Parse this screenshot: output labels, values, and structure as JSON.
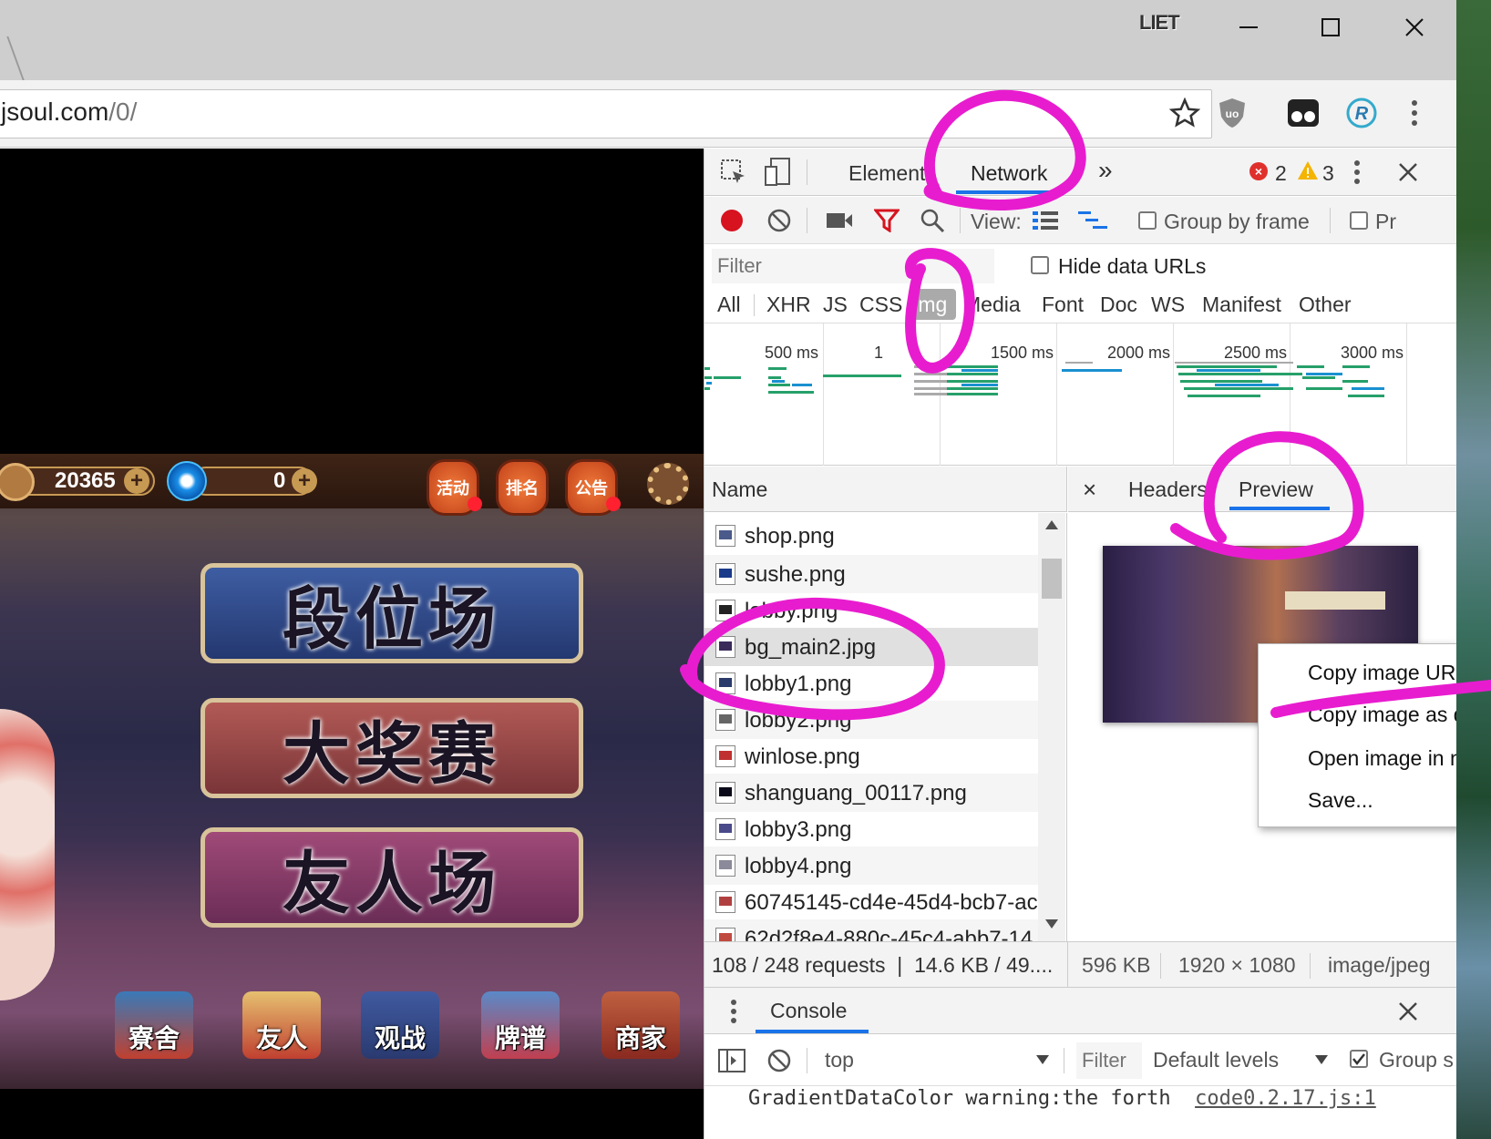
{
  "browser": {
    "user_badge": "LIET",
    "url_host": "jsoul.com",
    "url_path": "/0/"
  },
  "game": {
    "coins": "20365",
    "gems": "0",
    "lanterns": [
      "活动",
      "排名",
      "公告"
    ],
    "banners": [
      "段位场",
      "大奖赛",
      "友人场"
    ],
    "bottom_icons": [
      "寮舍",
      "友人",
      "观战",
      "牌谱",
      "商家"
    ]
  },
  "devtools": {
    "tabs": {
      "elements": "Elements",
      "network": "Network",
      "more": "»"
    },
    "errors": "2",
    "warnings": "3",
    "toolbar": {
      "view_label": "View:",
      "group_by_frame": "Group by frame",
      "preserve": "Pr"
    },
    "filter_placeholder": "Filter",
    "hide_data_urls": "Hide data URLs",
    "types": [
      "All",
      "XHR",
      "JS",
      "CSS",
      "Img",
      "Media",
      "Font",
      "Doc",
      "WS",
      "Manifest",
      "Other"
    ],
    "timeline_ticks": [
      "500 ms",
      "1",
      "1500 ms",
      "2000 ms",
      "2500 ms",
      "3000 ms"
    ],
    "name_header": "Name",
    "files": [
      "shop.png",
      "sushe.png",
      "lobby.png",
      "bg_main2.jpg",
      "lobby1.png",
      "lobby2.png",
      "winlose.png",
      "shanguang_00117.png",
      "lobby3.png",
      "lobby4.png",
      "60745145-cd4e-45d4-bcb7-ac",
      "62d2f8e4-880c-45c4-abb7-14"
    ],
    "status_requests": "108 / 248 requests",
    "status_size": "14.6 KB / 49....",
    "detail_tabs": {
      "close": "×",
      "headers": "Headers",
      "preview": "Preview",
      "more": "›"
    },
    "detail_status": {
      "size": "596 KB",
      "dimensions": "1920 × 1080",
      "mime": "image/jpeg"
    },
    "context_menu": [
      "Copy image URL",
      "Copy image as data URI",
      "Open image in new tab",
      "Save..."
    ],
    "drawer": {
      "title": "Console",
      "context": "top",
      "filter_placeholder": "Filter",
      "levels": "Default levels",
      "group": "Group s",
      "line_text": "GradientDataColor warning:the forth",
      "line_link": "code0.2.17.js:1"
    }
  }
}
